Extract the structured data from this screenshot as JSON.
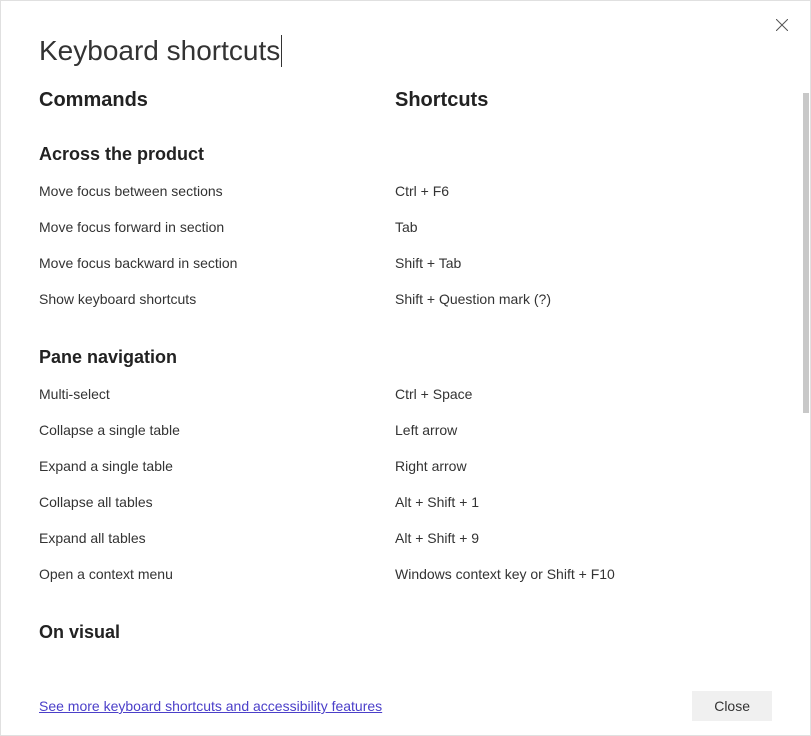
{
  "title": "Keyboard shortcuts",
  "columns": {
    "commands": "Commands",
    "shortcuts": "Shortcuts"
  },
  "sections": [
    {
      "title": "Across the product",
      "rows": [
        {
          "command": "Move focus between sections",
          "shortcut": "Ctrl + F6"
        },
        {
          "command": "Move focus forward in section",
          "shortcut": "Tab"
        },
        {
          "command": "Move focus backward in section",
          "shortcut": "Shift + Tab"
        },
        {
          "command": "Show keyboard shortcuts",
          "shortcut": "Shift + Question mark (?)"
        }
      ]
    },
    {
      "title": "Pane navigation",
      "rows": [
        {
          "command": "Multi-select",
          "shortcut": "Ctrl + Space"
        },
        {
          "command": "Collapse a single table",
          "shortcut": "Left arrow"
        },
        {
          "command": "Expand a single table",
          "shortcut": "Right arrow"
        },
        {
          "command": "Collapse all tables",
          "shortcut": "Alt + Shift + 1"
        },
        {
          "command": "Expand all tables",
          "shortcut": "Alt + Shift + 9"
        },
        {
          "command": "Open a context menu",
          "shortcut": "Windows context key or Shift + F10"
        }
      ]
    },
    {
      "title": "On visual",
      "rows": []
    }
  ],
  "footer": {
    "link": "See more keyboard shortcuts and accessibility features",
    "close": "Close"
  }
}
